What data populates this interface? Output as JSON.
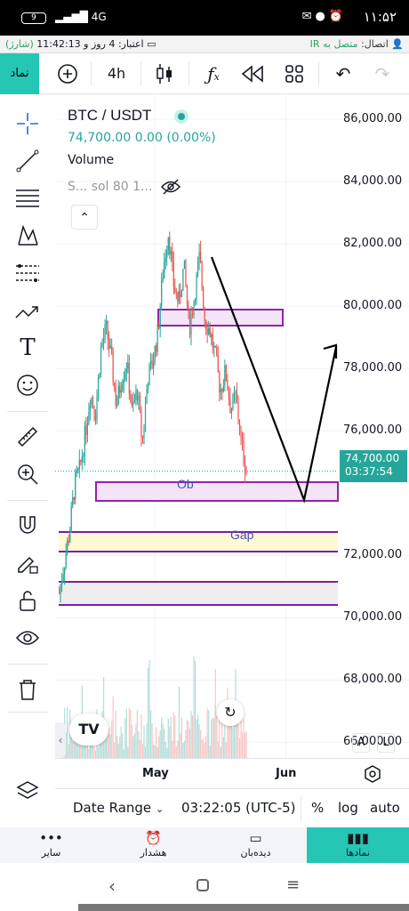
{
  "status_bar": {
    "time": "۱۱:۵۲",
    "battery": "9",
    "network": "4G",
    "icons": [
      "message-icon",
      "chat-icon",
      "alarm-icon"
    ]
  },
  "info_bar": {
    "connection_label": "اتصال:",
    "connection_value": "متصل به IR",
    "credit_label": "اعتبار:",
    "credit_value": "4 روز و 11:42:13",
    "credit_suffix": "(شارژ)"
  },
  "toolbar": {
    "symbol_label": "نماد",
    "interval": "4h"
  },
  "chart": {
    "symbol": "BTC / USDT",
    "last_price_line": "74,700.00  0.00 (0.00%)",
    "volume_label": "Volume",
    "indicator_label": "S... sol 80 1...",
    "status_dot_color": "#26a69a",
    "ob_label": "Ob",
    "gap_label": "Gap",
    "price_tag": "74,700.00",
    "countdown": "03:37:54",
    "scale_a": "A",
    "scale_l": "L"
  },
  "chart_data": {
    "type": "candlestick",
    "y_range": [
      65500,
      86800
    ],
    "price_ticks": [
      "86,000.00",
      "84,000.00",
      "82,000.00",
      "80,000.00",
      "78,000.00",
      "76,000.00",
      "72,000.00",
      "70,000.00",
      "68,000.00",
      "66,000.00"
    ],
    "price_tick_values": [
      86000,
      84000,
      82000,
      80000,
      78000,
      76000,
      72000,
      70000,
      68000,
      66000
    ],
    "current_price": 74700,
    "x_ticks": [
      "May",
      "Jun"
    ],
    "close_path": [
      70800,
      71800,
      72800,
      74300,
      74800,
      75900,
      77200,
      76600,
      78600,
      79300,
      78300,
      76800,
      77700,
      78200,
      76600,
      77300,
      75600,
      77700,
      78200,
      79200,
      81200,
      82400,
      80700,
      80100,
      81300,
      79300,
      80300,
      81600,
      79600,
      79200,
      78400,
      77300,
      77900,
      76700,
      77100,
      75600,
      74700
    ],
    "colors": {
      "up": "#26a69a",
      "down": "#ef5350"
    }
  },
  "bottom": {
    "x_label_may": "May",
    "x_label_jun": "Jun",
    "date_range": "Date Range",
    "clock": "03:22:05 (UTC-5)",
    "percent": "%",
    "log": "log",
    "auto": "auto"
  },
  "bottom_nav": {
    "items": [
      "سایر",
      "هشدار",
      "دیده‌بان",
      "نمادها"
    ]
  }
}
